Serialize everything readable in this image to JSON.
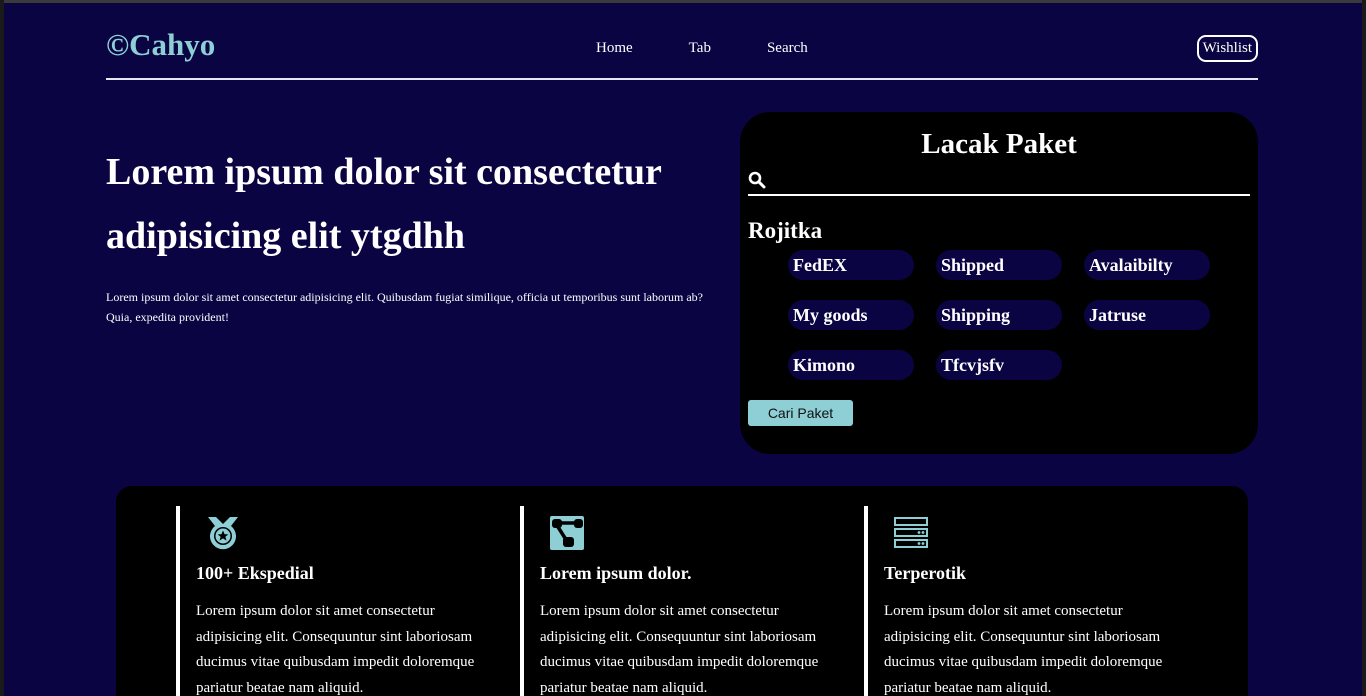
{
  "header": {
    "logo": "©Cahyo",
    "nav": [
      {
        "label": "Home"
      },
      {
        "label": "Tab"
      },
      {
        "label": "Search"
      }
    ],
    "wishlist_label": "Wishlist"
  },
  "hero": {
    "title": "Lorem ipsum dolor sit consectetur adipisicing elit ytgdhh",
    "description": "Lorem ipsum dolor sit amet consectetur adipisicing elit. Quibusdam fugiat similique, officia ut temporibus sunt laborum ab? Quia, expedita provident!"
  },
  "tracking": {
    "title": "Lacak Paket",
    "search_placeholder": "",
    "search_icon": "search-icon",
    "group_label": "Rojitka",
    "chips": [
      {
        "label": "FedEX"
      },
      {
        "label": "Shipped"
      },
      {
        "label": "Avalaibilty"
      },
      {
        "label": "My goods"
      },
      {
        "label": "Shipping"
      },
      {
        "label": "Jatruse"
      },
      {
        "label": "Kimono"
      },
      {
        "label": "Tfcvjsfv"
      }
    ],
    "button_label": "Cari Paket"
  },
  "features": [
    {
      "icon": "medal-icon",
      "title": "100+ Ekspedial",
      "text": "Lorem ipsum dolor sit amet consectetur adipisicing elit. Consequuntur sint laboriosam ducimus vitae quibusdam impedit doloremque pariatur beatae nam aliquid."
    },
    {
      "icon": "network-icon",
      "title": "Lorem ipsum dolor.",
      "text": "Lorem ipsum dolor sit amet consectetur adipisicing elit. Consequuntur sint laboriosam ducimus vitae quibusdam impedit doloremque pariatur beatae nam aliquid."
    },
    {
      "icon": "server-icon",
      "title": "Terperotik",
      "text": "Lorem ipsum dolor sit amet consectetur adipisicing elit. Consequuntur sint laboriosam ducimus vitae quibusdam impedit doloremque pariatur beatae nam aliquid."
    }
  ],
  "colors": {
    "background": "#0a0442",
    "card": "#000000",
    "accent": "#8ecfd6",
    "text": "#ffffff"
  }
}
